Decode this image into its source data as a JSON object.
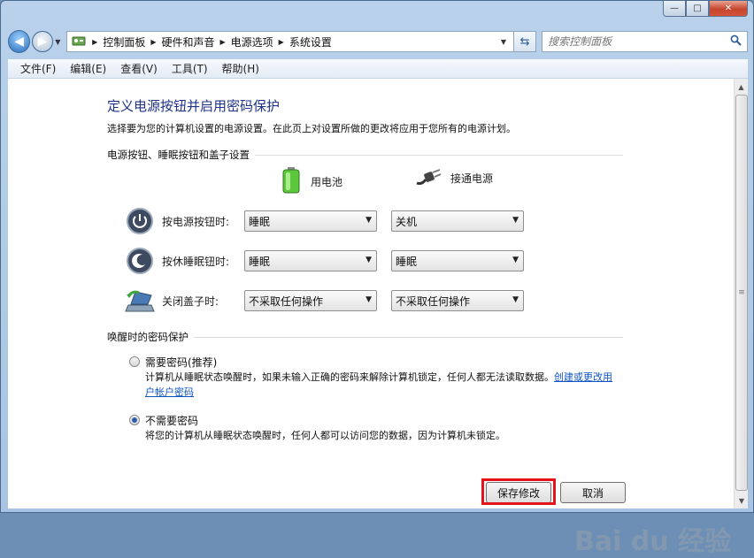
{
  "window": {
    "caption_buttons": {
      "minimize": "—",
      "maximize": "□",
      "close": "✕"
    }
  },
  "nav": {
    "breadcrumbs": [
      "控制面板",
      "硬件和声音",
      "电源选项",
      "系统设置"
    ],
    "search_placeholder": "搜索控制面板"
  },
  "menu": [
    "文件(F)",
    "编辑(E)",
    "查看(V)",
    "工具(T)",
    "帮助(H)"
  ],
  "page": {
    "title": "定义电源按钮并启用密码保护",
    "description": "选择要为您的计算机设置的电源设置。在此页上对设置所做的更改将应用于您所有的电源计划。"
  },
  "buttons_section": {
    "heading": "电源按钮、睡眠按钮和盖子设置",
    "col_battery": "用电池",
    "col_plugged": "接通电源",
    "rows": [
      {
        "label": "按电源按钮时:",
        "battery": "睡眠",
        "plugged": "关机",
        "icon": "power-button-icon"
      },
      {
        "label": "按休睡眠钮时:",
        "battery": "睡眠",
        "plugged": "睡眠",
        "icon": "sleep-button-icon"
      },
      {
        "label": "关闭盖子时:",
        "battery": "不采取任何操作",
        "plugged": "不采取任何操作",
        "icon": "laptop-lid-icon"
      }
    ]
  },
  "password_section": {
    "heading": "唤醒时的密码保护",
    "option_require": {
      "label": "需要密码(推荐)",
      "desc": "计算机从睡眠状态唤醒时，如果未输入正确的密码来解除计算机锁定，任何人都无法读取数据。",
      "link": "创建或更改用户帐户密码",
      "selected": false
    },
    "option_none": {
      "label": "不需要密码",
      "desc": "将您的计算机从睡眠状态唤醒时，任何人都可以访问您的数据，因为计算机未锁定。",
      "selected": true
    }
  },
  "footer": {
    "save": "保存修改",
    "cancel": "取消"
  },
  "watermark": "Bai du 经验",
  "colors": {
    "title": "#1e3287",
    "link": "#0f54c2",
    "highlight": "#e3141c"
  }
}
